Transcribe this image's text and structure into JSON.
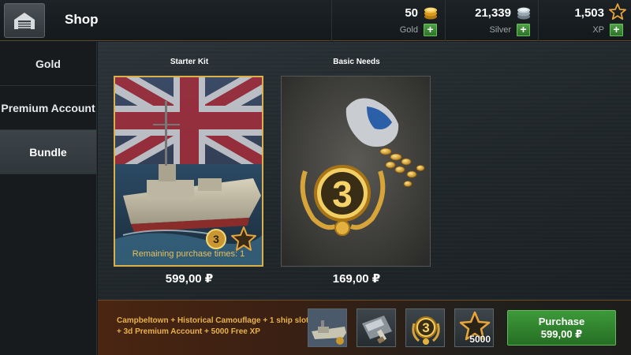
{
  "header": {
    "title": "Shop",
    "home_icon": "hangar-icon"
  },
  "currencies": [
    {
      "amount": "50",
      "label": "Gold",
      "icon": "gold-coins-icon",
      "action": "+"
    },
    {
      "amount": "21,339",
      "label": "Silver",
      "icon": "silver-coins-icon",
      "action": "+"
    },
    {
      "amount": "1,503",
      "label": "XP",
      "icon": "star-icon",
      "action": "+"
    }
  ],
  "sidebar": {
    "items": [
      {
        "label": "Gold",
        "active": false
      },
      {
        "label": "Premium Account",
        "active": false
      },
      {
        "label": "Bundle",
        "active": true
      }
    ]
  },
  "cards": [
    {
      "title": "Starter Kit",
      "price": "599,00 ₽",
      "remaining": "Remaining purchase times: 1",
      "badge_number": "3",
      "selected": true
    },
    {
      "title": "Basic Needs",
      "price": "169,00 ₽",
      "badge_number": "3",
      "selected": false
    }
  ],
  "bundle": {
    "description": "Campbeltown + Historical Camouflage + 1 ship slot + 3d Premium Account + 5000 Free XP",
    "items": [
      {
        "icon": "ship-icon"
      },
      {
        "icon": "camouflage-icon"
      },
      {
        "icon": "premium-badge-icon",
        "label": "3"
      },
      {
        "icon": "free-xp-star-icon",
        "quantity": "5000"
      }
    ],
    "purchase_label": "Purchase",
    "purchase_price": "599,00 ₽"
  },
  "colors": {
    "accent_gold": "#d9b04a",
    "purchase_green": "#2f8a2d",
    "plus_green": "#3f9a3a"
  }
}
